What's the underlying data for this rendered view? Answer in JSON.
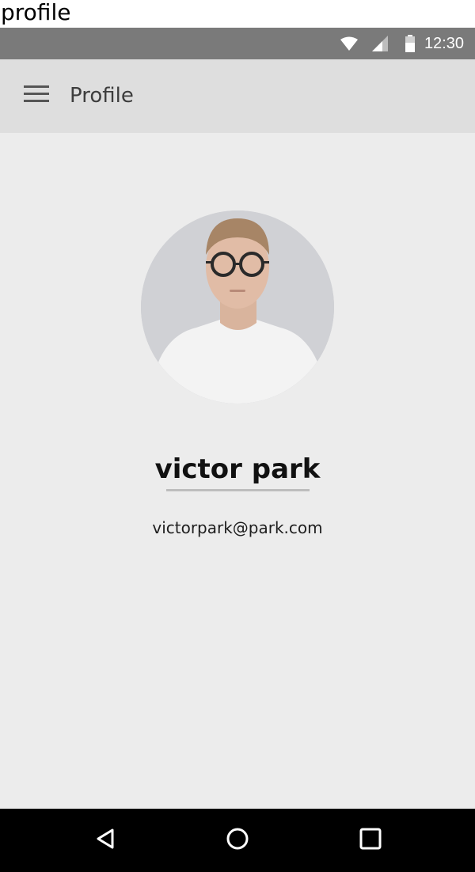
{
  "caption": "profile",
  "status_bar": {
    "time": "12:30",
    "icons": [
      "wifi-icon",
      "cell-signal-icon",
      "battery-icon"
    ]
  },
  "app_bar": {
    "menu_icon": "hamburger-menu-icon",
    "title": "Profile"
  },
  "profile": {
    "name": "victor park",
    "email": "victorpark@park.com"
  },
  "nav_bar": {
    "icons": [
      "back-icon",
      "home-icon",
      "recents-icon"
    ]
  },
  "colors": {
    "status_bar": "#7a7a7a",
    "app_bar": "#dedede",
    "content_background": "#ececec",
    "nav_bar": "#000000"
  }
}
